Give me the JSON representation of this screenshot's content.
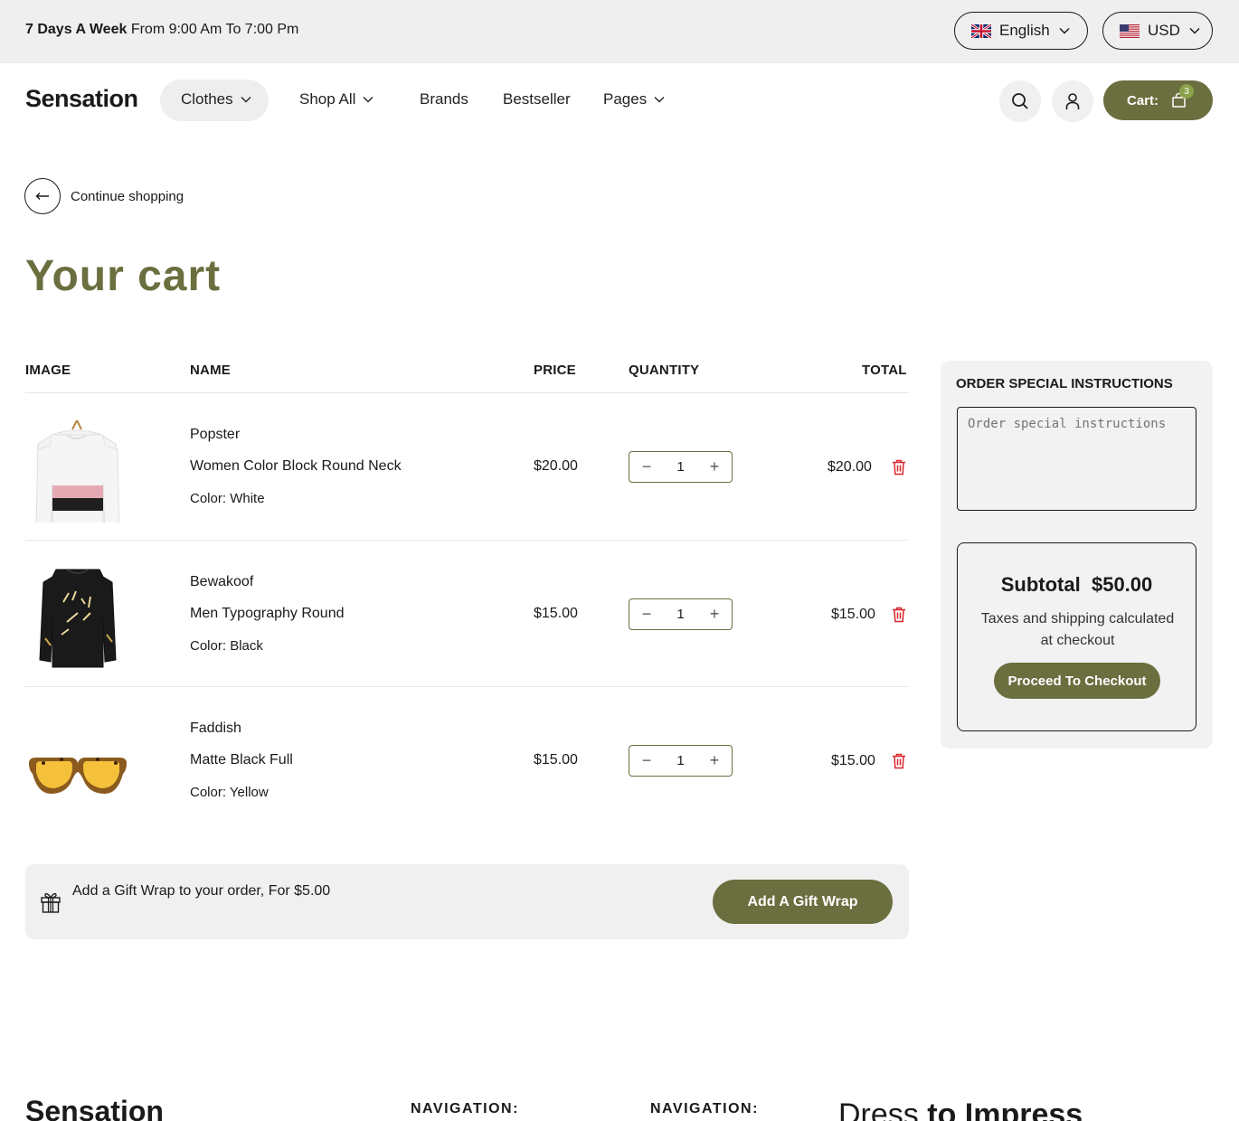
{
  "topbar": {
    "hours_bold": "7 Days A Week",
    "hours_rest": "From 9:00 Am To 7:00 Pm",
    "language": "English",
    "currency": "USD"
  },
  "header": {
    "logo": "Sensation",
    "nav": [
      "Clothes",
      "Shop All",
      "Brands",
      "Bestseller",
      "Pages"
    ],
    "cart_label": "Cart:",
    "cart_count": "3"
  },
  "continue_label": "Continue shopping",
  "page_title": "Your cart",
  "table": {
    "headers": [
      "IMAGE",
      "NAME",
      "PRICE",
      "QUANTITY",
      "TOTAL"
    ],
    "rows": [
      {
        "brand": "Popster",
        "name": "Women Color Block Round Neck",
        "color_label": "Color:",
        "color": "White",
        "price": "$20.00",
        "qty": "1",
        "total": "$20.00"
      },
      {
        "brand": "Bewakoof",
        "name": "Men Typography Round",
        "color_label": "Color:",
        "color": "Black",
        "price": "$15.00",
        "qty": "1",
        "total": "$15.00"
      },
      {
        "brand": "Faddish",
        "name": "Matte Black Full",
        "color_label": "Color:",
        "color": "Yellow",
        "price": "$15.00",
        "qty": "1",
        "total": "$15.00"
      }
    ]
  },
  "gift": {
    "text": "Add a Gift Wrap to your order, For $5.00",
    "button": "Add A Gift Wrap"
  },
  "sidebar": {
    "title": "ORDER SPECIAL INSTRUCTIONS",
    "placeholder": "Order special instructions",
    "subtotal_label": "Subtotal",
    "subtotal_value": "$50.00",
    "taxes": "Taxes and shipping calculated at checkout",
    "checkout": "Proceed To Checkout"
  },
  "footer": {
    "logo": "Sensation",
    "nav1": "NAVIGATION:",
    "nav2": "NAVIGATION:",
    "tagline_a": "Dress",
    "tagline_b": "to Impress"
  },
  "colors": {
    "accent": "#6b6e3e",
    "badge": "#8aa34a",
    "trash": "#d9262c"
  }
}
